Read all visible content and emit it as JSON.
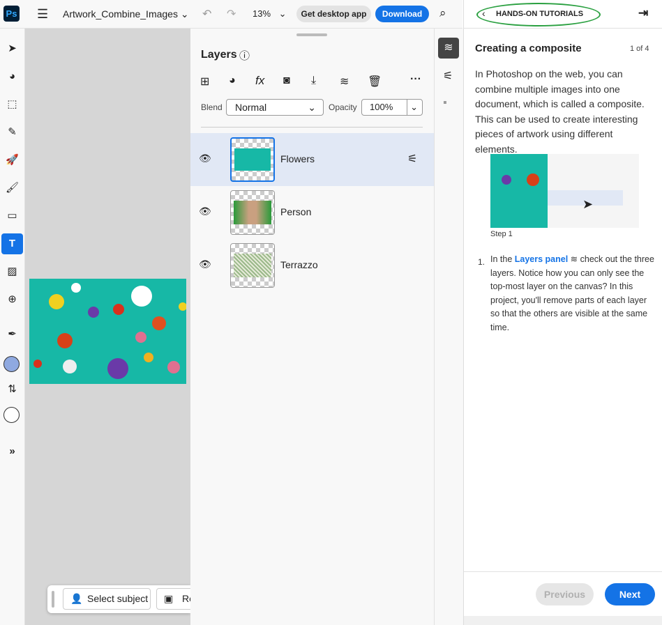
{
  "topbar": {
    "app_logo": "Ps",
    "doc_title": "Artwork_Combine_Images",
    "zoom": "13%",
    "get_desktop": "Get desktop app",
    "download": "Download"
  },
  "tools": [
    "select",
    "adjust",
    "quick-selection",
    "healing",
    "quick-actions",
    "brush",
    "shape",
    "type",
    "generative-fill",
    "add-image",
    "eyedropper",
    "foreground-color",
    "swap-colors",
    "background-color",
    "more"
  ],
  "colors": {
    "accent": "#1473e6",
    "foreground": "#8fa9e0",
    "background": "#ffffff",
    "canvas_bg": "#17b8a6"
  },
  "layers": {
    "title": "Layers",
    "blend_label": "Blend",
    "blend_value": "Normal",
    "opacity_label": "Opacity",
    "opacity_value": "100%",
    "items": [
      {
        "name": "Flowers",
        "selected": true
      },
      {
        "name": "Person",
        "selected": false
      },
      {
        "name": "Terrazzo",
        "selected": false
      }
    ]
  },
  "taskbar": {
    "select_subject": "Select subject",
    "remove_bg": "Re"
  },
  "tutorial": {
    "header": "HANDS-ON TUTORIALS",
    "title": "Creating a composite",
    "page": "1 of 4",
    "intro": "In Photoshop on the web, you can combine multiple images into one document, which is called a composite. This can be used to create interesting pieces of artwork using different elements.",
    "step_caption": "Step 1",
    "step_num": "1.",
    "step_pre": "In the ",
    "step_link": "Layers panel",
    "step_post": " check out the three layers. Notice how you can only see the top-most layer on the canvas? In this project, you'll remove parts of each layer so that the others are visible at the same time.",
    "previous": "Previous",
    "next": "Next"
  }
}
